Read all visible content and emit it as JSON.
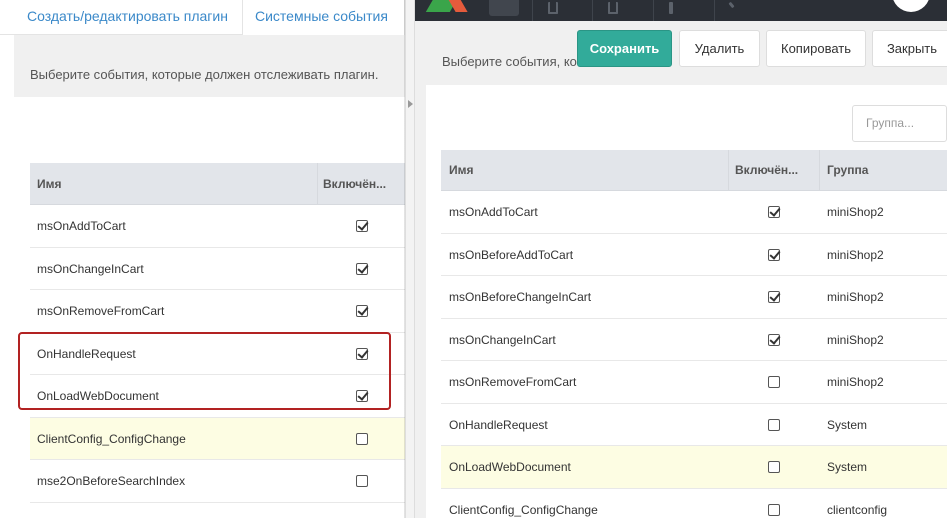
{
  "left": {
    "tabs": [
      {
        "label": "Создать/редактировать плагин"
      },
      {
        "label": "Системные события"
      }
    ],
    "description": "Выберите события, которые должен отслеживать плагин.",
    "grid": {
      "columns": [
        "Имя",
        "Включён..."
      ],
      "rows": [
        {
          "name": "msOnAddToCart",
          "enabled": true,
          "highlight": false
        },
        {
          "name": "msOnChangeInCart",
          "enabled": true,
          "highlight": false
        },
        {
          "name": "msOnRemoveFromCart",
          "enabled": true,
          "highlight": false
        },
        {
          "name": "OnHandleRequest",
          "enabled": true,
          "highlight": false
        },
        {
          "name": "OnLoadWebDocument",
          "enabled": true,
          "highlight": false
        },
        {
          "name": "ClientConfig_ConfigChange",
          "enabled": false,
          "highlight": true
        },
        {
          "name": "mse2OnBeforeSearchIndex",
          "enabled": false,
          "highlight": false
        }
      ]
    }
  },
  "right": {
    "description": "Выберите события, ко",
    "toolbar": {
      "save_label": "Сохранить",
      "delete_label": "Удалить",
      "copy_label": "Копировать",
      "close_label": "Закрыть"
    },
    "group_filter": {
      "placeholder": "Группа..."
    },
    "grid": {
      "columns": [
        "Имя",
        "Включён...",
        "Группа"
      ],
      "rows": [
        {
          "name": "msOnAddToCart",
          "enabled": true,
          "group": "miniShop2",
          "highlight": false
        },
        {
          "name": "msOnBeforeAddToCart",
          "enabled": true,
          "group": "miniShop2",
          "highlight": false
        },
        {
          "name": "msOnBeforeChangeInCart",
          "enabled": true,
          "group": "miniShop2",
          "highlight": false
        },
        {
          "name": "msOnChangeInCart",
          "enabled": true,
          "group": "miniShop2",
          "highlight": false
        },
        {
          "name": "msOnRemoveFromCart",
          "enabled": false,
          "group": "miniShop2",
          "highlight": false
        },
        {
          "name": "OnHandleRequest",
          "enabled": false,
          "group": "System",
          "highlight": false
        },
        {
          "name": "OnLoadWebDocument",
          "enabled": false,
          "group": "System",
          "highlight": true
        },
        {
          "name": "ClientConfig_ConfigChange",
          "enabled": false,
          "group": "clientconfig",
          "highlight": false
        }
      ]
    }
  },
  "colors": {
    "accent": "#3b89c9",
    "save_button": "#32ab9a",
    "highlight_row": "#fdfde3",
    "annotation_box": "#b22222",
    "topbar": "#2b2f36"
  },
  "icons": [
    "modx-logo-icon",
    "search-icon",
    "checkbox-icon",
    "collapse-arrow-icon",
    "user-avatar-icon"
  ]
}
